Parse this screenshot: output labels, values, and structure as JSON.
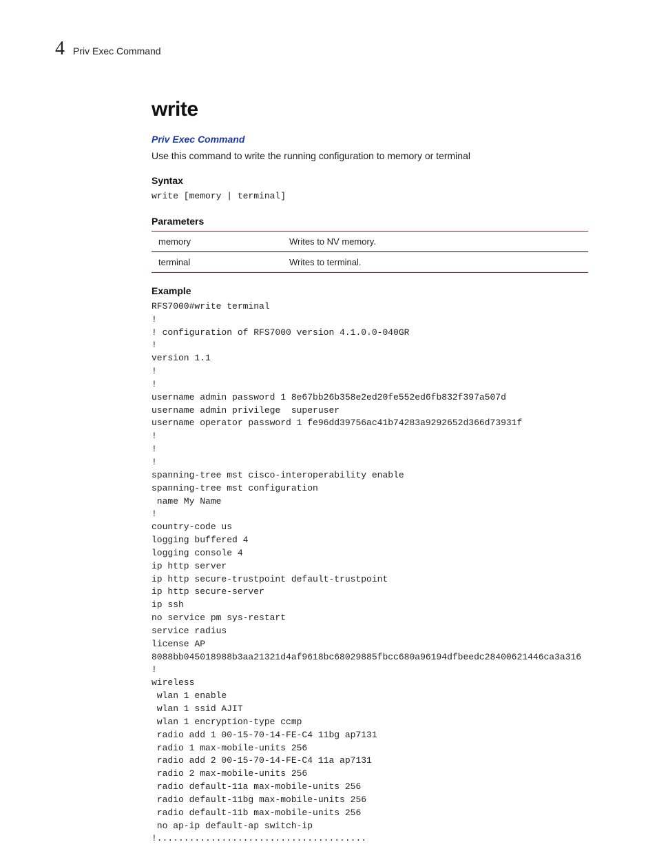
{
  "running_head": {
    "chapter_number": "4",
    "chapter_title": "Priv Exec Command"
  },
  "command_title": "write",
  "section_link": "Priv Exec Command",
  "description": "Use this command to write the running configuration to memory or terminal",
  "syntax": {
    "heading": "Syntax",
    "code": "write [memory | terminal]"
  },
  "parameters": {
    "heading": "Parameters",
    "rows": [
      {
        "name": "memory",
        "desc": "Writes to NV memory."
      },
      {
        "name": "terminal",
        "desc": "Writes to terminal."
      }
    ]
  },
  "example": {
    "heading": "Example",
    "code": "RFS7000#write terminal\n!\n! configuration of RFS7000 version 4.1.0.0-040GR\n!\nversion 1.1\n!\n!\nusername admin password 1 8e67bb26b358e2ed20fe552ed6fb832f397a507d\nusername admin privilege  superuser\nusername operator password 1 fe96dd39756ac41b74283a9292652d366d73931f\n!\n!\n!\nspanning-tree mst cisco-interoperability enable\nspanning-tree mst configuration\n name My Name\n!\ncountry-code us\nlogging buffered 4\nlogging console 4\nip http server\nip http secure-trustpoint default-trustpoint\nip http secure-server\nip ssh\nno service pm sys-restart\nservice radius\nlicense AP \n8088bb045018988b3aa21321d4af9618bc68029885fbcc680a96194dfbeedc28400621446ca3a316\n!\nwireless\n wlan 1 enable\n wlan 1 ssid AJIT\n wlan 1 encryption-type ccmp\n radio add 1 00-15-70-14-FE-C4 11bg ap7131\n radio 1 max-mobile-units 256\n radio add 2 00-15-70-14-FE-C4 11a ap7131\n radio 2 max-mobile-units 256\n radio default-11a max-mobile-units 256\n radio default-11bg max-mobile-units 256\n radio default-11b max-mobile-units 256\n no ap-ip default-ap switch-ip\n!......................................."
  }
}
